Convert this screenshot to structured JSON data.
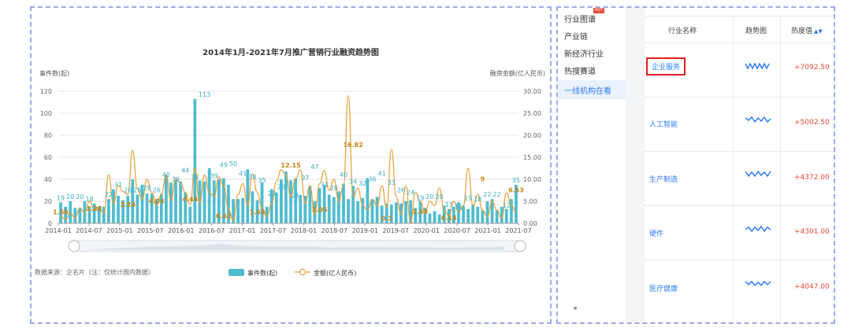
{
  "chart_data": {
    "type": "bar+line",
    "title": "2014年1月-2021年7月推广营销行业融资趋势图",
    "ylabel_left": "事件数(起)",
    "ylabel_right": "融资金额(亿人民币)",
    "ylim_left": [
      0,
      120
    ],
    "ylim_right": [
      0,
      30
    ],
    "yticks_left": [
      "0",
      "20",
      "40",
      "60",
      "80",
      "100",
      "120"
    ],
    "yticks_right": [
      "0.00",
      "5.00",
      "10.00",
      "15.00",
      "20.00",
      "25.00",
      "30.00"
    ],
    "x_ticks": [
      "2014-01",
      "2014-07",
      "2015-01",
      "2015-07",
      "2016-01",
      "2016-07",
      "2017-01",
      "2017-07",
      "2018-01",
      "2018-07",
      "2019-01",
      "2019-07",
      "2020-01",
      "2020-07",
      "2021-01",
      "2021-07"
    ],
    "series": [
      {
        "name": "事件数(起)",
        "type": "bar",
        "color": "#4fbcd0",
        "values": [
          19,
          15,
          20,
          14,
          14,
          20,
          15,
          18,
          15,
          15,
          22,
          31,
          25,
          21,
          25,
          40,
          26,
          35,
          27,
          27,
          22,
          27,
          44,
          37,
          39,
          38,
          28,
          15,
          113,
          39,
          38,
          50,
          39,
          40,
          41,
          35,
          22,
          22,
          23,
          49,
          29,
          21,
          37,
          15,
          31,
          28,
          40,
          47,
          39,
          41,
          26,
          25,
          34,
          20,
          32,
          35,
          26,
          24,
          29,
          36,
          22,
          34,
          20,
          23,
          41,
          22,
          24,
          16,
          18,
          17,
          19,
          18,
          20,
          21,
          14,
          20,
          14,
          9,
          11,
          8,
          16,
          13,
          15,
          19,
          16,
          13,
          17,
          15,
          12,
          20,
          22,
          12,
          15,
          13,
          22,
          35
        ]
      },
      {
        "name": "金额(亿人民币)",
        "type": "line",
        "color": "#e4a23a",
        "values": [
          1.56,
          0.8,
          2.28,
          1.2,
          3.5,
          2.4,
          5.0,
          3.1,
          3.24,
          2.2,
          11.0,
          4.5,
          8.6,
          7.2,
          6.53,
          16.5,
          8.0,
          5.5,
          10.0,
          7.0,
          4.04,
          6.5,
          11.0,
          5.2,
          10.2,
          9.0,
          7.0,
          4.3,
          12.5,
          4.44,
          11.0,
          7.0,
          6.0,
          10.5,
          8.5,
          3.2,
          0.62,
          6.5,
          9.0,
          4.0,
          11.2,
          7.0,
          3.5,
          1.56,
          4.5,
          9.5,
          12.15,
          11.0,
          6.0,
          10.0,
          12.15,
          4.5,
          8.5,
          2.05,
          9.0,
          12.0,
          7.5,
          10.0,
          5.0,
          8.5,
          29.0,
          6.0,
          8.0,
          4.0,
          3.0,
          5.5,
          4.0,
          8.5,
          3.5,
          16.82,
          6.0,
          2.0,
          8.5,
          0.1,
          7.0,
          5.0,
          2.5,
          5.0,
          4.0,
          8.0,
          3.0,
          1.63,
          5.0,
          2.5,
          4.0,
          12.5,
          4.0,
          6.5,
          3.0,
          1.5,
          5.0,
          3.0,
          1.14,
          7.0,
          4.0,
          2.5
        ]
      }
    ],
    "bar_labels": [
      "19",
      "20",
      "20",
      "18",
      "8",
      "22",
      "31",
      "26",
      "26",
      "28",
      "26",
      "40",
      "36",
      "44",
      "38",
      "113",
      "39",
      "49",
      "50",
      "41",
      "38",
      "35",
      "23",
      "29",
      "21",
      "37",
      "47",
      "31",
      "28",
      "40",
      "34",
      "32",
      "36",
      "41",
      "33",
      "26",
      "24",
      "19",
      "20",
      "20",
      "13",
      "11",
      "19",
      "18",
      "22",
      "22",
      "12",
      "35"
    ],
    "line_labels": [
      "1.56",
      "2.28",
      "3.24",
      "4.04",
      "4.44",
      "0.62",
      "1.56",
      "12.15",
      "2.05",
      "16.82",
      "0.1",
      "1.63",
      "0.14",
      "9",
      "6.53"
    ],
    "legend": [
      {
        "label": "事件数(起)",
        "kind": "bar"
      },
      {
        "label": "金额(亿人民币)",
        "kind": "line"
      }
    ],
    "legend_position": "bottom-center",
    "source": "数据来源：企名片（注：仅统计国内数据）"
  },
  "nav": {
    "items": [
      {
        "label": "行业图谱",
        "active": false,
        "hot": true
      },
      {
        "label": "产业链",
        "active": false,
        "hot": false
      },
      {
        "label": "新经济行业",
        "active": false,
        "hot": false
      },
      {
        "label": "热搜赛道",
        "active": false,
        "hot": false
      },
      {
        "label": "一线机构在看",
        "active": true,
        "hot": false
      }
    ],
    "hot_badge": "HOT"
  },
  "table": {
    "headers": [
      "行业名称",
      "趋势图",
      "热度值"
    ],
    "rows": [
      {
        "name": "企业服务",
        "value": "+7092.50",
        "boxed": true
      },
      {
        "name": "人工智能",
        "value": "+5002.50",
        "boxed": false
      },
      {
        "name": "生产制造",
        "value": "+4372.00",
        "boxed": false
      },
      {
        "name": "硬件",
        "value": "+4301.00",
        "boxed": false
      },
      {
        "name": "医疗健康",
        "value": "+4047.00",
        "boxed": false
      }
    ],
    "accent": "#2f7cf6",
    "value_color": "#e8483a"
  }
}
